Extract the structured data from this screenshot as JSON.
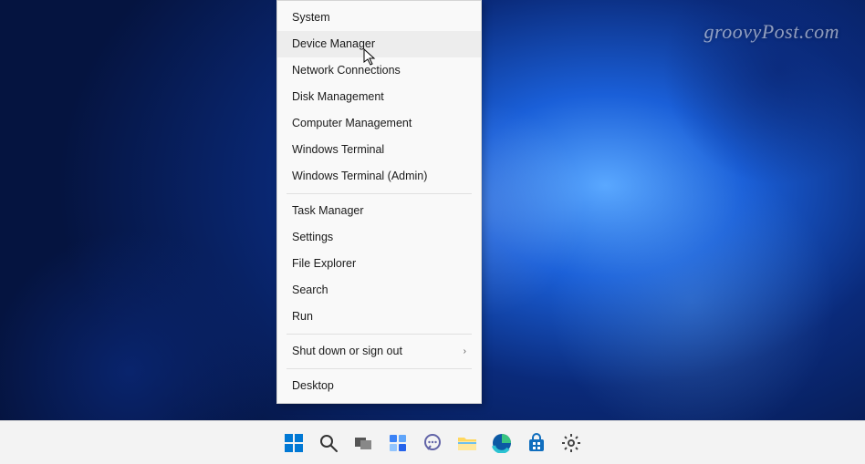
{
  "watermark": "groovyPost.com",
  "menu": {
    "groups": [
      [
        {
          "id": "system",
          "label": "System",
          "submenu": false,
          "hover": false
        },
        {
          "id": "device-manager",
          "label": "Device Manager",
          "submenu": false,
          "hover": true
        },
        {
          "id": "network-connections",
          "label": "Network Connections",
          "submenu": false,
          "hover": false
        },
        {
          "id": "disk-management",
          "label": "Disk Management",
          "submenu": false,
          "hover": false
        },
        {
          "id": "computer-management",
          "label": "Computer Management",
          "submenu": false,
          "hover": false
        },
        {
          "id": "windows-terminal",
          "label": "Windows Terminal",
          "submenu": false,
          "hover": false
        },
        {
          "id": "windows-terminal-admin",
          "label": "Windows Terminal (Admin)",
          "submenu": false,
          "hover": false
        }
      ],
      [
        {
          "id": "task-manager",
          "label": "Task Manager",
          "submenu": false,
          "hover": false
        },
        {
          "id": "settings",
          "label": "Settings",
          "submenu": false,
          "hover": false
        },
        {
          "id": "file-explorer",
          "label": "File Explorer",
          "submenu": false,
          "hover": false
        },
        {
          "id": "search",
          "label": "Search",
          "submenu": false,
          "hover": false
        },
        {
          "id": "run",
          "label": "Run",
          "submenu": false,
          "hover": false
        }
      ],
      [
        {
          "id": "shutdown",
          "label": "Shut down or sign out",
          "submenu": true,
          "hover": false
        }
      ],
      [
        {
          "id": "desktop",
          "label": "Desktop",
          "submenu": false,
          "hover": false
        }
      ]
    ]
  },
  "taskbar": {
    "items": [
      {
        "id": "start",
        "name": "start-icon"
      },
      {
        "id": "search",
        "name": "search-icon"
      },
      {
        "id": "taskview",
        "name": "task-view-icon"
      },
      {
        "id": "widgets",
        "name": "widgets-icon"
      },
      {
        "id": "chat",
        "name": "chat-icon"
      },
      {
        "id": "explorer",
        "name": "file-explorer-icon"
      },
      {
        "id": "edge",
        "name": "edge-icon"
      },
      {
        "id": "store",
        "name": "store-icon"
      },
      {
        "id": "settings",
        "name": "settings-icon"
      }
    ]
  }
}
